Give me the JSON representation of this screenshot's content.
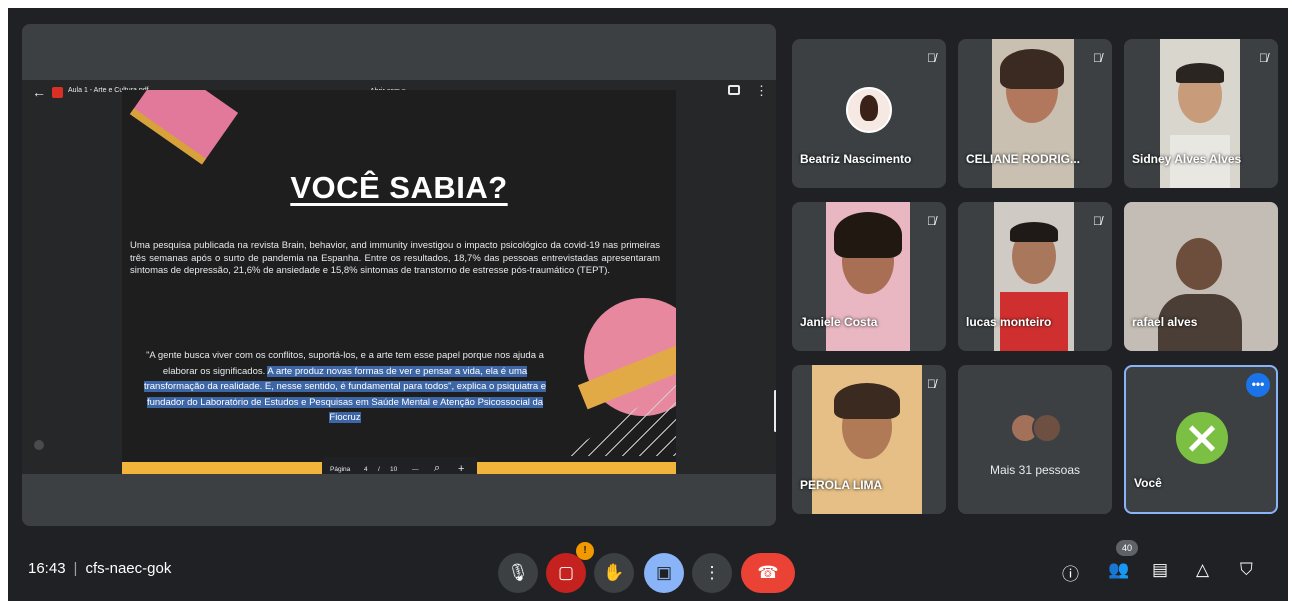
{
  "viewer": {
    "file_name": "Aula 1 - Arte e Cultura.pdf",
    "open_with": "Abrir com ▾",
    "page_label": "Página",
    "page_current": "4",
    "page_sep": "/",
    "page_total": "10",
    "zoom_minus": "—",
    "zoom_plus": "+"
  },
  "slide": {
    "title": "VOCÊ SABIA?",
    "paragraph": "Uma pesquisa publicada na revista Brain, behavior, and immunity investigou o impacto psicológico da covid-19 nas primeiras três semanas após o surto de pandemia na Espanha. Entre os resultados, 18,7% das pessoas entrevistadas apresentaram sintomas de depressão, 21,6% de ansiedade e 15,8% sintomas de transtorno de estresse pós-traumático (TEPT).",
    "quote_plain": "\"A gente busca viver com os conflitos, suportá-los, e a arte tem esse papel porque nos ajuda a elaborar os significados. ",
    "quote_highlight": "A arte produz novas formas de ver e pensar a vida, ela é uma transformação da realidade. E, nesse sentido, é fundamental para todos\", explica o psiquiatra e fundador do Laboratório de Estudos e Pesquisas em Saúde Mental e Atenção Psicossocial da Fiocruz"
  },
  "participants": [
    {
      "name": "Beatriz Nascimento",
      "muted": true
    },
    {
      "name": "CELIANE RODRIG...",
      "muted": true
    },
    {
      "name": "Sidney Alves Alves",
      "muted": true
    },
    {
      "name": "Janiele Costa",
      "muted": true
    },
    {
      "name": "lucas monteiro",
      "muted": true
    },
    {
      "name": "rafael alves",
      "muted": false
    },
    {
      "name": "PEROLA LIMA",
      "muted": true
    },
    {
      "name": "Mais 31 pessoas",
      "muted": false
    },
    {
      "name": "Você",
      "muted": false
    }
  ],
  "bottom": {
    "time": "16:43",
    "separator": "|",
    "meeting_code": "cfs-naec-gok",
    "camera_badge": "!",
    "participants_count": "40"
  },
  "colors": {
    "background": "#202124",
    "tile": "#3c4043",
    "accent_blue": "#8ab4f8",
    "end_call_red": "#ea4335",
    "warning_orange": "#f29900"
  }
}
